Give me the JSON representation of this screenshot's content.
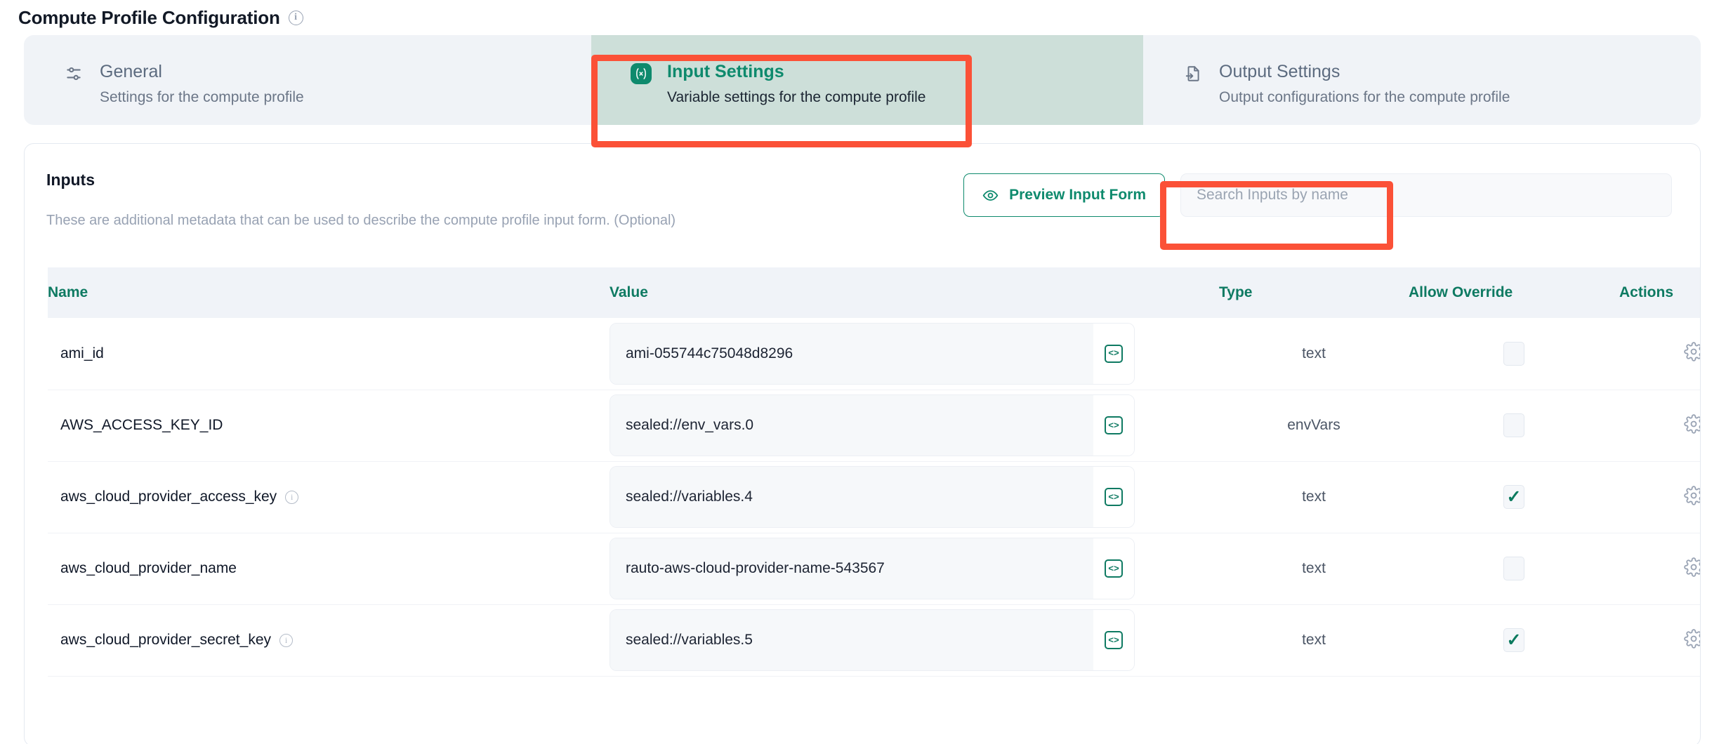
{
  "header": {
    "title": "Compute Profile Configuration",
    "info_icon": "info-circle-icon"
  },
  "tabs": [
    {
      "id": "general",
      "label": "General",
      "description": "Settings for the compute profile",
      "icon": "sliders-icon",
      "active": false
    },
    {
      "id": "input-settings",
      "label": "Input Settings",
      "description": "Variable settings for the compute profile",
      "icon": "variable-icon",
      "active": true
    },
    {
      "id": "output-settings",
      "label": "Output Settings",
      "description": "Output configurations for the compute profile",
      "icon": "file-export-icon",
      "active": false
    }
  ],
  "inputs_section": {
    "title": "Inputs",
    "description": "These are additional metadata that can be used to describe the compute profile input form. (Optional)",
    "preview_button_label": "Preview Input Form",
    "preview_button_icon": "eye-icon",
    "search_placeholder": "Search Inputs by name"
  },
  "table": {
    "columns": [
      "Name",
      "Value",
      "Type",
      "Allow Override",
      "Actions"
    ],
    "rows": [
      {
        "name": "ami_id",
        "has_info": false,
        "value": "ami-055744c75048d8296",
        "type": "text",
        "allow_override": false,
        "action_icon": "gear-icon",
        "value_icon": "code-brackets-icon"
      },
      {
        "name": "AWS_ACCESS_KEY_ID",
        "has_info": false,
        "value": "sealed://env_vars.0",
        "type": "envVars",
        "allow_override": false,
        "action_icon": "gear-icon",
        "value_icon": "code-brackets-icon"
      },
      {
        "name": "aws_cloud_provider_access_key",
        "has_info": true,
        "value": "sealed://variables.4",
        "type": "text",
        "allow_override": true,
        "action_icon": "gear-icon",
        "value_icon": "code-brackets-icon"
      },
      {
        "name": "aws_cloud_provider_name",
        "has_info": false,
        "value": "rauto-aws-cloud-provider-name-543567",
        "type": "text",
        "allow_override": false,
        "action_icon": "gear-icon",
        "value_icon": "code-brackets-icon"
      },
      {
        "name": "aws_cloud_provider_secret_key",
        "has_info": true,
        "value": "sealed://variables.5",
        "type": "text",
        "allow_override": true,
        "action_icon": "gear-icon",
        "value_icon": "code-brackets-icon"
      }
    ]
  },
  "colors": {
    "accent_teal": "#0e8a6d",
    "header_teal": "#0e7a62",
    "active_tab_bg": "#cddfd9",
    "highlight_red": "#fb5137",
    "tabstrip_bg": "#f0f3f7"
  }
}
